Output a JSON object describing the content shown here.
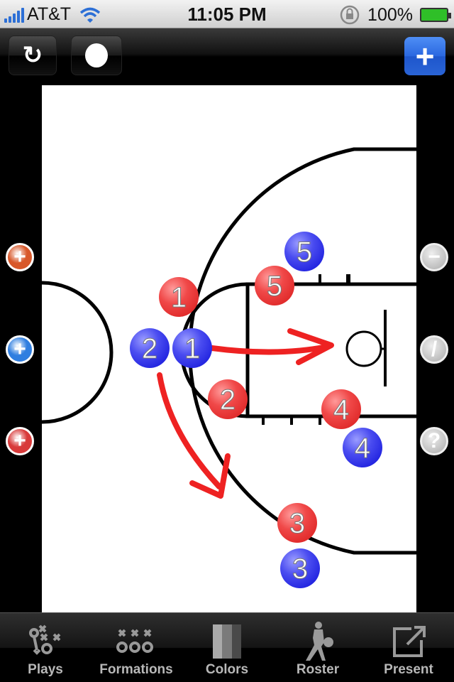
{
  "status_bar": {
    "carrier": "AT&T",
    "time": "11:05 PM",
    "battery": "100%"
  },
  "toolbar": {
    "refresh_icon": "↻",
    "add_label": "+"
  },
  "colors": {
    "offense": "#e8282e",
    "defense": "#2a2ee6",
    "draw": "#ee2222",
    "accent": "#2a68e0"
  },
  "side_left": [
    {
      "name": "add-orange",
      "label": "+",
      "color": "#d8582a"
    },
    {
      "name": "add-blue",
      "label": "+",
      "color": "#2f7ee0"
    },
    {
      "name": "add-red",
      "label": "+",
      "color": "#d83a3a"
    }
  ],
  "side_right": [
    {
      "name": "remove",
      "label": "−"
    },
    {
      "name": "draw",
      "label": "/"
    },
    {
      "name": "help",
      "label": "?"
    }
  ],
  "players": {
    "offense": [
      {
        "number": "1"
      },
      {
        "number": "2"
      },
      {
        "number": "3"
      },
      {
        "number": "4"
      },
      {
        "number": "5"
      }
    ],
    "defense": [
      {
        "number": "1"
      },
      {
        "number": "2"
      },
      {
        "number": "3"
      },
      {
        "number": "4"
      },
      {
        "number": "5"
      }
    ]
  },
  "tabs": [
    {
      "label": "Plays",
      "icon": "plays-icon"
    },
    {
      "label": "Formations",
      "icon": "formations-icon"
    },
    {
      "label": "Colors",
      "icon": "colors-icon"
    },
    {
      "label": "Roster",
      "icon": "roster-icon"
    },
    {
      "label": "Present",
      "icon": "present-icon"
    }
  ]
}
